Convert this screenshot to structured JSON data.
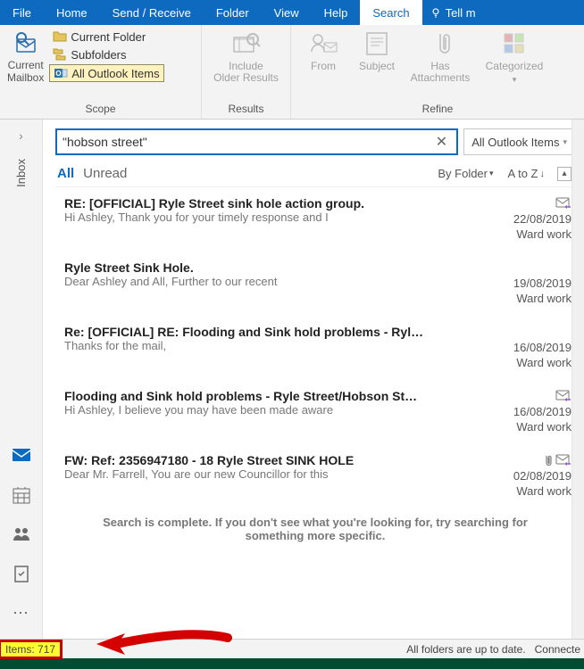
{
  "menu": {
    "items": [
      "File",
      "Home",
      "Send / Receive",
      "Folder",
      "View",
      "Help",
      "Search"
    ],
    "active": "Search",
    "tellme": "Tell m"
  },
  "ribbon": {
    "scope": {
      "label": "Scope",
      "mailbox": "Current\nMailbox",
      "opts": [
        "Current Folder",
        "Subfolders",
        "All Outlook Items"
      ],
      "selected": 2
    },
    "results": {
      "label": "Results",
      "include": "Include\nOlder Results"
    },
    "refine": {
      "label": "Refine",
      "from": "From",
      "subject": "Subject",
      "hasatt": "Has\nAttachments",
      "categorized": "Categorized"
    }
  },
  "search": {
    "query": "\"hobson street\"",
    "scope": "All Outlook Items"
  },
  "nav": {
    "inbox": "Inbox"
  },
  "filters": {
    "all": "All",
    "unread": "Unread",
    "byfolder": "By Folder",
    "atoz": "A to Z"
  },
  "messages": [
    {
      "subject": "RE: [OFFICIAL] Ryle Street sink hole action group.",
      "preview": "Hi Ashley,   Thank you for your timely response and I",
      "date": "22/08/2019",
      "folder": "Ward work",
      "reply": true,
      "att": false
    },
    {
      "subject": "Ryle Street Sink Hole.",
      "preview": "Dear Ashley and All,   Further to our recent",
      "date": "19/08/2019",
      "folder": "Ward work",
      "reply": false,
      "att": false
    },
    {
      "subject": "Re: [OFFICIAL] RE: Flooding and Sink hold problems - Ryl…",
      "preview": "Thanks for the mail,",
      "date": "16/08/2019",
      "folder": "Ward work",
      "reply": false,
      "att": false
    },
    {
      "subject": "Flooding and Sink hold problems - Ryle Street/Hobson St…",
      "preview": "Hi Ashley, I believe you may have been made aware",
      "date": "16/08/2019",
      "folder": "Ward work",
      "reply": true,
      "att": false
    },
    {
      "subject": "FW: Ref: 2356947180 - 18 Ryle Street SINK HOLE",
      "preview": "Dear Mr. Farrell, You are our new Councillor for this",
      "date": "02/08/2019",
      "folder": "Ward work",
      "reply": true,
      "att": true
    }
  ],
  "searchend": "Search is complete. If you don't see what you're looking for, try searching for something more specific.",
  "status": {
    "items_label": "Items:",
    "items_count": "717",
    "sync": "All folders are up to date.",
    "conn": "Connecte"
  }
}
